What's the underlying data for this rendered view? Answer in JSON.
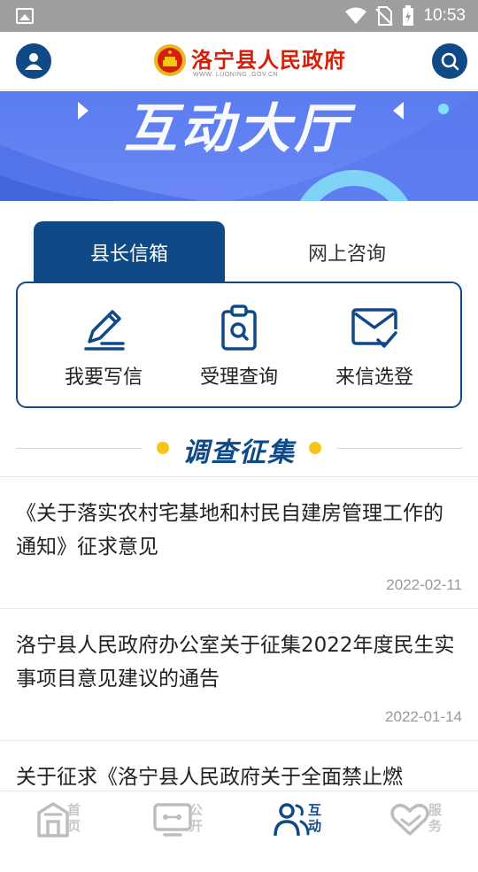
{
  "status_bar": {
    "time": "10:53"
  },
  "header": {
    "title": "洛宁县人民政府",
    "subtitle": "WWW. LUONING .GOV.CN"
  },
  "banner": {
    "title": "互动大厅"
  },
  "tabs": [
    {
      "label": "县长信箱",
      "active": true
    },
    {
      "label": "网上咨询",
      "active": false
    }
  ],
  "actions": [
    {
      "label": "我要写信",
      "icon": "pen-icon"
    },
    {
      "label": "受理查询",
      "icon": "clipboard-search-icon"
    },
    {
      "label": "来信选登",
      "icon": "mail-check-icon"
    }
  ],
  "section": {
    "title": "调查征集"
  },
  "news": [
    {
      "title": "《关于落实农村宅基地和村民自建房管理工作的通知》征求意见",
      "date": "2022-02-11"
    },
    {
      "title": "洛宁县人民政府办公室关于征集2022年度民生实事项目意见建议的通告",
      "date": "2022-01-14"
    },
    {
      "title": "关于征求《洛宁县人民政府关于全面禁止燃",
      "date": ""
    }
  ],
  "bottom_nav": [
    {
      "label": "首页",
      "icon": "building-icon",
      "active": false
    },
    {
      "label": "公开",
      "icon": "monitor-icon",
      "active": false
    },
    {
      "label": "互动",
      "icon": "users-icon",
      "active": true
    },
    {
      "label": "服务",
      "icon": "heart-icon",
      "active": false
    }
  ],
  "colors": {
    "primary": "#0f4a87",
    "accent_red": "#d81e06",
    "banner_blue": "#6b88f5",
    "dot_yellow": "#f5c518",
    "nav_inactive": "#bdbdbd"
  }
}
